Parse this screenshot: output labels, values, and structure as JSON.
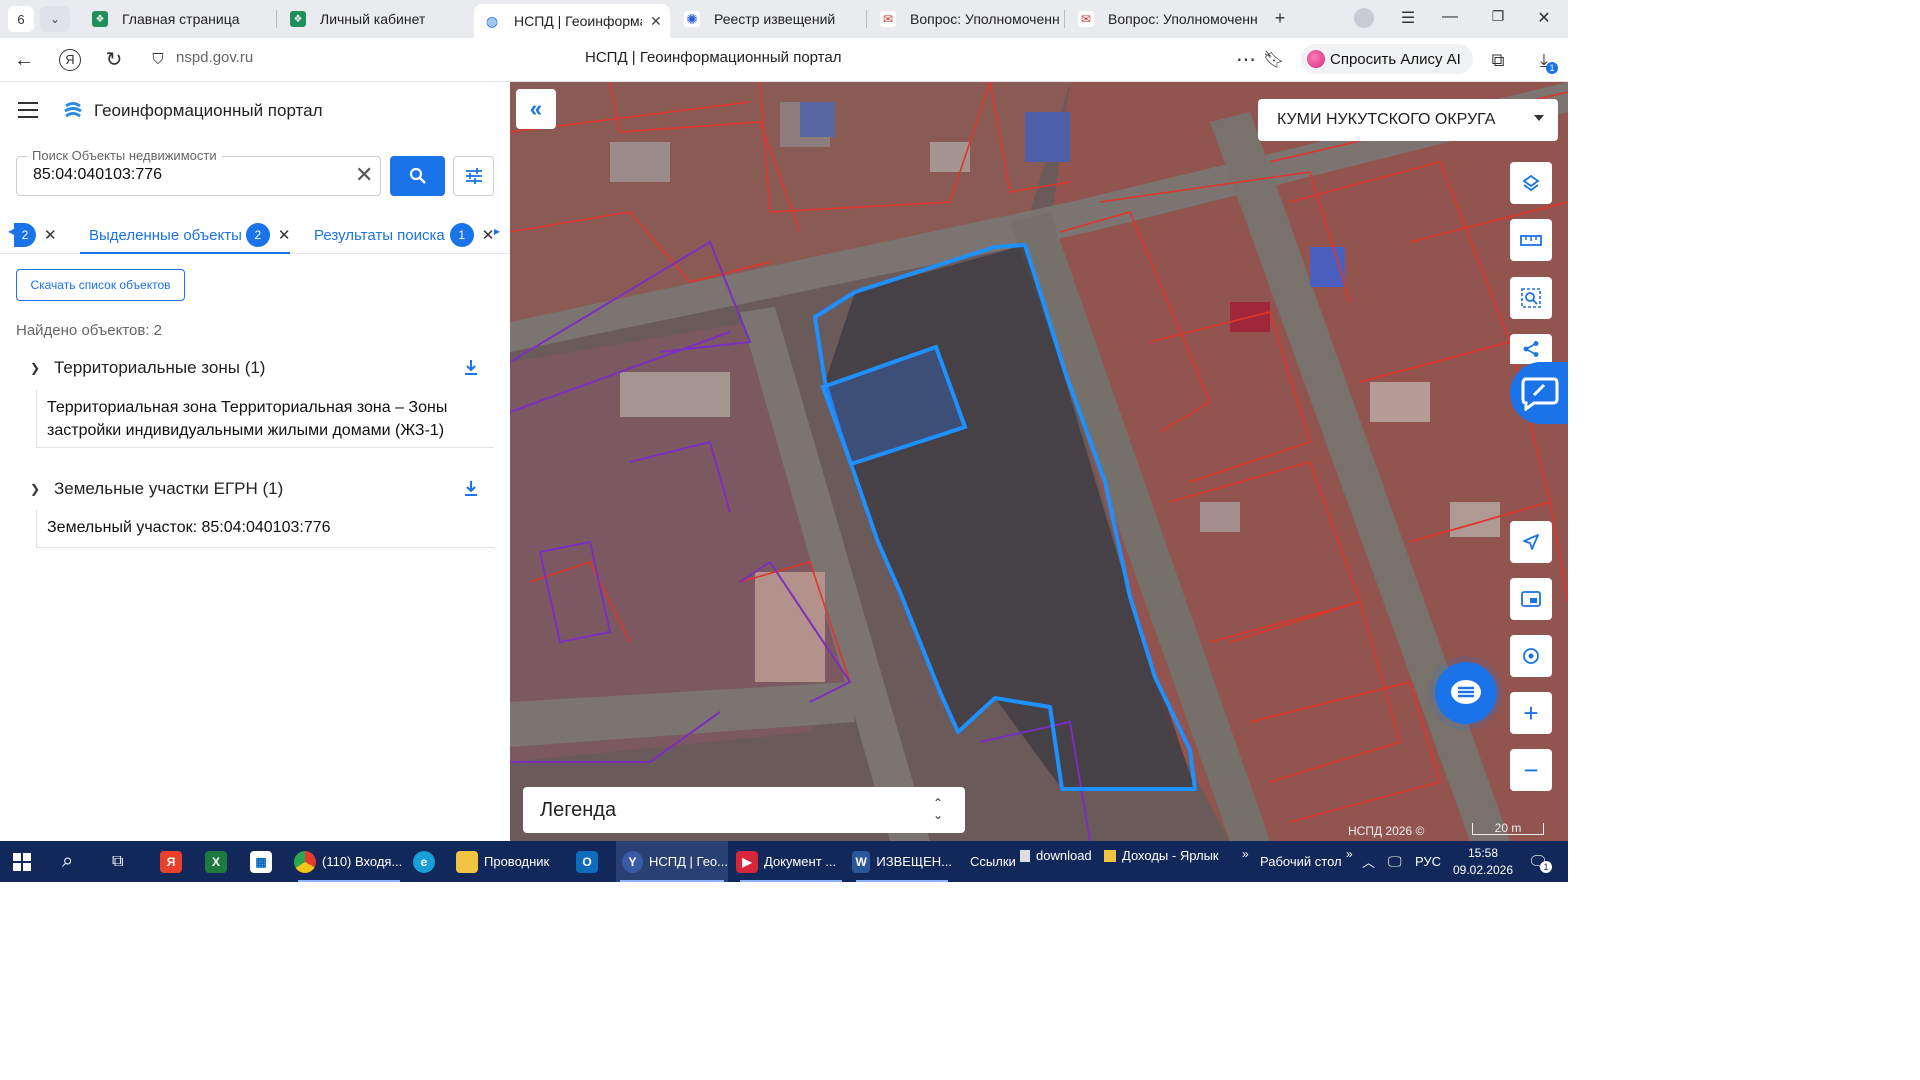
{
  "browser": {
    "tab_count": "6",
    "tabs": [
      {
        "title": "Главная страница"
      },
      {
        "title": "Личный кабинет"
      },
      {
        "title": "НСПД | Геоинформац"
      },
      {
        "title": "Реестр извещений"
      },
      {
        "title": "Вопрос: Уполномоченнь"
      },
      {
        "title": "Вопрос: Уполномоченнь"
      }
    ],
    "url": "nspd.gov.ru",
    "page_title": "НСПД | Геоинформационный портал",
    "alisa_label": "Спросить Алису AI",
    "download_badge": "1"
  },
  "panel": {
    "title": "Геоинформационный портал",
    "search": {
      "label": "Поиск Объекты недвижимости",
      "value": "85:04:040103:776"
    },
    "tabs": [
      {
        "label": "",
        "badge": "2"
      },
      {
        "label": "Выделенные объекты",
        "badge": "2"
      },
      {
        "label": "Результаты поиска",
        "badge": "1"
      }
    ],
    "download_list_label": "Скачать список объектов",
    "found_label": "Найдено объектов: 2",
    "groups": [
      {
        "title": "Территориальные зоны (1)",
        "items": [
          "Территориальная зона Территориальная зона – Зоны застройки индивидуальными жилыми домами (ЖЗ-1)"
        ]
      },
      {
        "title": "Земельные участки ЕГРН (1)",
        "items": [
          "Земельный участок: 85:04:040103:776"
        ]
      }
    ]
  },
  "map": {
    "organization": "КУМИ НУКУТСКОГО ОКРУГА",
    "legend_label": "Легенда",
    "copyright": "НСПД 2026 ©",
    "scale_label": "20 m",
    "colors": {
      "selection": "#1e90ff",
      "parcel_border": "#e0352b",
      "zone_border": "#7a2fc0",
      "accent": "#1a73e8"
    }
  },
  "taskbar": {
    "items": [
      {
        "label": "(110) Входя..."
      },
      {
        "label": "Проводник"
      },
      {
        "label": "НСПД | Гео..."
      },
      {
        "label": "Документ ..."
      },
      {
        "label": "ИЗВЕЩЕН..."
      }
    ],
    "links_label": "Ссылки",
    "quick": [
      {
        "label": "download"
      },
      {
        "label": "Доходы - Ярлык"
      }
    ],
    "desktop_label": "Рабочий стол",
    "lang": "РУС",
    "time": "15:58",
    "date": "09.02.2026",
    "notif_count": "1"
  }
}
